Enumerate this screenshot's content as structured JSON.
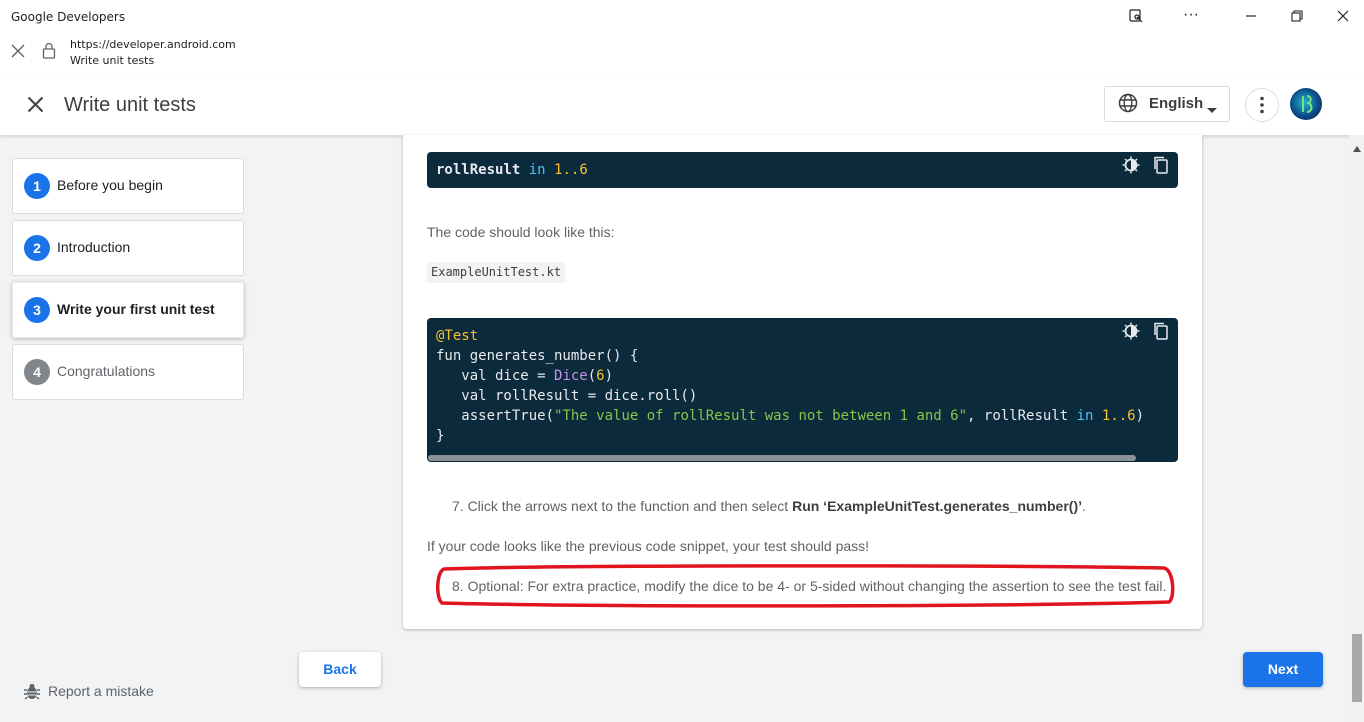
{
  "window": {
    "title": "Google Developers",
    "url": "https://developer.android.com",
    "page_title": "Write unit tests"
  },
  "header": {
    "title": "Write unit tests",
    "language": "English"
  },
  "steps": [
    {
      "num": "1",
      "label": "Before you begin"
    },
    {
      "num": "2",
      "label": "Introduction"
    },
    {
      "num": "3",
      "label": "Write your first unit test"
    },
    {
      "num": "4",
      "label": "Congratulations"
    }
  ],
  "content": {
    "snippet1": {
      "var": "rollResult",
      "kw": "in",
      "range": "1..6"
    },
    "intro_text": "The code should look like this:",
    "file_name": "ExampleUnitTest.kt",
    "snippet2": {
      "annotation": "@Test",
      "fun_line": "fun generates_number() {",
      "dice_prefix": "   val dice = ",
      "dice_class": "Dice",
      "dice_paren_open": "(",
      "dice_arg": "6",
      "dice_paren_close": ")",
      "roll_line": "   val rollResult = dice.roll()",
      "assert_prefix": "   assertTrue(",
      "assert_string": "\"The value of rollResult was not between 1 and 6\"",
      "assert_mid": ", rollResult ",
      "assert_kw": "in",
      "assert_range": " 1..6",
      "assert_close": ")",
      "close_brace": "}"
    },
    "step7_prefix": "7. Click the arrows next to the function and then select ",
    "step7_bold": "Run ‘ExampleUnitTest.generates_number()’",
    "step7_suffix": ".",
    "pass_text": "If your code looks like the previous code snippet, your test should pass!",
    "step8": "8. Optional: For extra practice, modify the dice to be 4- or 5-sided without changing the assertion to see the test fail."
  },
  "footer": {
    "back": "Back",
    "next": "Next",
    "report": "Report a mistake"
  },
  "colors": {
    "accent": "#1a73e8",
    "code_bg": "#0b2a3b",
    "highlight": "#e0141e"
  }
}
